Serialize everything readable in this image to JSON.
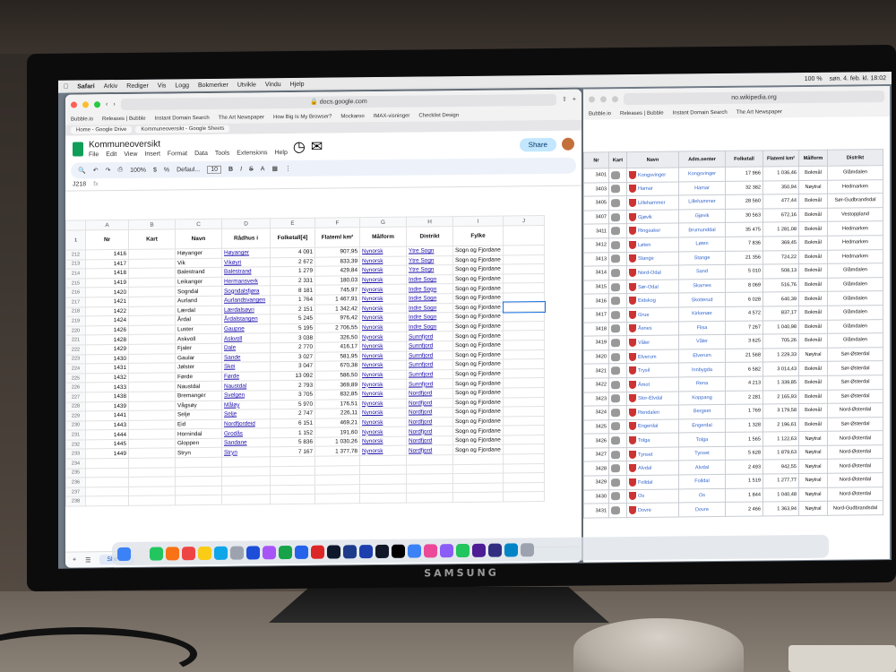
{
  "menubar": {
    "app": "Safari",
    "items": [
      "Arkiv",
      "Rediger",
      "Vis",
      "Logg",
      "Bokmerker",
      "Utvikle",
      "Vindu",
      "Hjelp"
    ],
    "clock": "søn. 4. feb. kl. 18:02",
    "battery": "100 %"
  },
  "left": {
    "url": "docs.google.com",
    "bookmarks": [
      "Bubble.io",
      "Releases | Bubble",
      "Instant Domain Search",
      "The Art Newspaper",
      "How Big Is My Browser?",
      "Mockaroo",
      "IMAX-visninger",
      "Checklist Design"
    ],
    "tabs": [
      "Home - Google Drive",
      "Kommuneoversikt - Google Sheets"
    ],
    "doc_title": "Kommuneoversikt",
    "menu": [
      "File",
      "Edit",
      "View",
      "Insert",
      "Format",
      "Data",
      "Tools",
      "Extensions",
      "Help"
    ],
    "share_label": "Share",
    "zoom": "100%",
    "font": "Defaul...",
    "font_size": "10",
    "cell_ref": "J218",
    "fx": "fx",
    "sheet_tab": "Sheet1",
    "col_letters": [
      "A",
      "B",
      "C",
      "D",
      "E",
      "F",
      "G",
      "H",
      "I",
      "J"
    ],
    "headers": [
      "Nr",
      "Kart",
      "Navn",
      "Rådhus i",
      "Folketall[4]",
      "Flateml km²",
      "Målform",
      "Distrikt",
      "Fylke",
      ""
    ],
    "rows": [
      {
        "rn": "212",
        "nr": "1416",
        "navn": "Høyanger",
        "rad": "Høyanger",
        "folk": "4 091",
        "flat": "907,95",
        "mal": "Nynorsk",
        "dist": "Ytre Sogn",
        "fyl": "Sogn og Fjordane"
      },
      {
        "rn": "213",
        "nr": "1417",
        "navn": "Vik",
        "rad": "Vikøyri",
        "folk": "2 672",
        "flat": "833,39",
        "mal": "Nynorsk",
        "dist": "Ytre Sogn",
        "fyl": "Sogn og Fjordane"
      },
      {
        "rn": "214",
        "nr": "1418",
        "navn": "Balestrand",
        "rad": "Balestrand",
        "folk": "1 279",
        "flat": "429,84",
        "mal": "Nynorsk",
        "dist": "Ytre Sogn",
        "fyl": "Sogn og Fjordane"
      },
      {
        "rn": "215",
        "nr": "1419",
        "navn": "Leikanger",
        "rad": "Hermansverk",
        "folk": "2 331",
        "flat": "180,03",
        "mal": "Nynorsk",
        "dist": "Indre Sogn",
        "fyl": "Sogn og Fjordane"
      },
      {
        "rn": "216",
        "nr": "1420",
        "navn": "Sogndal",
        "rad": "Sogndalsfjøra",
        "folk": "8 181",
        "flat": "745,97",
        "mal": "Nynorsk",
        "dist": "Indre Sogn",
        "fyl": "Sogn og Fjordane"
      },
      {
        "rn": "217",
        "nr": "1421",
        "navn": "Aurland",
        "rad": "Aurlandsvangen",
        "folk": "1 764",
        "flat": "1 467,91",
        "mal": "Nynorsk",
        "dist": "Indre Sogn",
        "fyl": "Sogn og Fjordane"
      },
      {
        "rn": "218",
        "nr": "1422",
        "navn": "Lærdal",
        "rad": "Lærdalsøyri",
        "folk": "2 151",
        "flat": "1 342,42",
        "mal": "Nynorsk",
        "dist": "Indre Sogn",
        "fyl": "Sogn og Fjordane"
      },
      {
        "rn": "219",
        "nr": "1424",
        "navn": "Årdal",
        "rad": "Årdalstangen",
        "folk": "5 245",
        "flat": "976,42",
        "mal": "Nynorsk",
        "dist": "Indre Sogn",
        "fyl": "Sogn og Fjordane"
      },
      {
        "rn": "220",
        "nr": "1426",
        "navn": "Luster",
        "rad": "Gaupne",
        "folk": "5 195",
        "flat": "2 706,55",
        "mal": "Nynorsk",
        "dist": "Indre Sogn",
        "fyl": "Sogn og Fjordane"
      },
      {
        "rn": "221",
        "nr": "1428",
        "navn": "Askvoll",
        "rad": "Askvoll",
        "folk": "3 038",
        "flat": "326,50",
        "mal": "Nynorsk",
        "dist": "Sunnfjord",
        "fyl": "Sogn og Fjordane"
      },
      {
        "rn": "222",
        "nr": "1429",
        "navn": "Fjaler",
        "rad": "Dale",
        "folk": "2 770",
        "flat": "416,17",
        "mal": "Nynorsk",
        "dist": "Sunnfjord",
        "fyl": "Sogn og Fjordane"
      },
      {
        "rn": "223",
        "nr": "1430",
        "navn": "Gaular",
        "rad": "Sande",
        "folk": "3 027",
        "flat": "581,95",
        "mal": "Nynorsk",
        "dist": "Sunnfjord",
        "fyl": "Sogn og Fjordane"
      },
      {
        "rn": "224",
        "nr": "1431",
        "navn": "Jølster",
        "rad": "Skei",
        "folk": "3 047",
        "flat": "670,38",
        "mal": "Nynorsk",
        "dist": "Sunnfjord",
        "fyl": "Sogn og Fjordane"
      },
      {
        "rn": "225",
        "nr": "1432",
        "navn": "Førde",
        "rad": "Førde",
        "folk": "13 092",
        "flat": "586,50",
        "mal": "Nynorsk",
        "dist": "Sunnfjord",
        "fyl": "Sogn og Fjordane"
      },
      {
        "rn": "226",
        "nr": "1433",
        "navn": "Naustdal",
        "rad": "Naustdal",
        "folk": "2 793",
        "flat": "369,89",
        "mal": "Nynorsk",
        "dist": "Sunnfjord",
        "fyl": "Sogn og Fjordane"
      },
      {
        "rn": "227",
        "nr": "1438",
        "navn": "Bremanger",
        "rad": "Svelgen",
        "folk": "3 705",
        "flat": "832,85",
        "mal": "Nynorsk",
        "dist": "Nordfjord",
        "fyl": "Sogn og Fjordane"
      },
      {
        "rn": "228",
        "nr": "1439",
        "navn": "Vågsøy",
        "rad": "Måløy",
        "folk": "5 970",
        "flat": "176,51",
        "mal": "Nynorsk",
        "dist": "Nordfjord",
        "fyl": "Sogn og Fjordane"
      },
      {
        "rn": "229",
        "nr": "1441",
        "navn": "Selje",
        "rad": "Selje",
        "folk": "2 747",
        "flat": "226,11",
        "mal": "Nynorsk",
        "dist": "Nordfjord",
        "fyl": "Sogn og Fjordane"
      },
      {
        "rn": "230",
        "nr": "1443",
        "navn": "Eid",
        "rad": "Nordfjordeid",
        "folk": "6 151",
        "flat": "469,21",
        "mal": "Nynorsk",
        "dist": "Nordfjord",
        "fyl": "Sogn og Fjordane"
      },
      {
        "rn": "231",
        "nr": "1444",
        "navn": "Hornindal",
        "rad": "Grodås",
        "folk": "1 152",
        "flat": "191,60",
        "mal": "Nynorsk",
        "dist": "Nordfjord",
        "fyl": "Sogn og Fjordane"
      },
      {
        "rn": "232",
        "nr": "1445",
        "navn": "Gloppen",
        "rad": "Sandane",
        "folk": "5 836",
        "flat": "1 030,26",
        "mal": "Nynorsk",
        "dist": "Nordfjord",
        "fyl": "Sogn og Fjordane"
      },
      {
        "rn": "233",
        "nr": "1449",
        "navn": "Stryn",
        "rad": "Stryn",
        "folk": "7 167",
        "flat": "1 377,78",
        "mal": "Nynorsk",
        "dist": "Nordfjord",
        "fyl": "Sogn og Fjordane"
      }
    ],
    "empty_rows": [
      "234",
      "235",
      "236",
      "237",
      "238"
    ]
  },
  "right": {
    "url": "no.wikipedia.org",
    "bookmarks": [
      "Bubble.io",
      "Releases | Bubble",
      "Instant Domain Search",
      "The Art Newspaper"
    ],
    "headers": [
      "Nr",
      "Kart",
      "Navn",
      "Adm.senter",
      "Folketall",
      "Flateml km²",
      "Målform",
      "Distrikt"
    ],
    "rows": [
      {
        "nr": "3401",
        "navn": "Kongsvinger",
        "adm": "Kongsvinger",
        "folk": "17 966",
        "flat": "1 036,46",
        "mal": "Bokmål",
        "dist": "Glåmdalen"
      },
      {
        "nr": "3403",
        "navn": "Hamar",
        "adm": "Hamar",
        "folk": "32 382",
        "flat": "350,94",
        "mal": "Nøytral",
        "dist": "Hedmarken"
      },
      {
        "nr": "3405",
        "navn": "Lillehammer",
        "adm": "Lillehammer",
        "folk": "28 560",
        "flat": "477,44",
        "mal": "Bokmål",
        "dist": "Sør-Gudbrandsdal"
      },
      {
        "nr": "3407",
        "navn": "Gjøvik",
        "adm": "Gjøvik",
        "folk": "30 563",
        "flat": "672,16",
        "mal": "Bokmål",
        "dist": "Vestoppland"
      },
      {
        "nr": "3411",
        "navn": "Ringsaker",
        "adm": "Brumunddal",
        "folk": "35 475",
        "flat": "1 281,08",
        "mal": "Bokmål",
        "dist": "Hedmarken"
      },
      {
        "nr": "3412",
        "navn": "Løten",
        "adm": "Løten",
        "folk": "7 836",
        "flat": "369,45",
        "mal": "Bokmål",
        "dist": "Hedmarken"
      },
      {
        "nr": "3413",
        "navn": "Stange",
        "adm": "Stange",
        "folk": "21 356",
        "flat": "724,22",
        "mal": "Bokmål",
        "dist": "Hedmarken"
      },
      {
        "nr": "3414",
        "navn": "Nord-Odal",
        "adm": "Sand",
        "folk": "5 010",
        "flat": "508,13",
        "mal": "Bokmål",
        "dist": "Glåmdalen"
      },
      {
        "nr": "3415",
        "navn": "Sør-Odal",
        "adm": "Skarnes",
        "folk": "8 069",
        "flat": "516,76",
        "mal": "Bokmål",
        "dist": "Glåmdalen"
      },
      {
        "nr": "3416",
        "navn": "Eidskog",
        "adm": "Skotterud",
        "folk": "6 028",
        "flat": "640,39",
        "mal": "Bokmål",
        "dist": "Glåmdalen"
      },
      {
        "nr": "3417",
        "navn": "Grue",
        "adm": "Kirkenær",
        "folk": "4 572",
        "flat": "837,17",
        "mal": "Bokmål",
        "dist": "Glåmdalen"
      },
      {
        "nr": "3418",
        "navn": "Åsnes",
        "adm": "Flisa",
        "folk": "7 267",
        "flat": "1 040,98",
        "mal": "Bokmål",
        "dist": "Glåmdalen"
      },
      {
        "nr": "3419",
        "navn": "Våler",
        "adm": "Våler",
        "folk": "3 625",
        "flat": "705,26",
        "mal": "Bokmål",
        "dist": "Glåmdalen"
      },
      {
        "nr": "3420",
        "navn": "Elverum",
        "adm": "Elverum",
        "folk": "21 568",
        "flat": "1 229,33",
        "mal": "Nøytral",
        "dist": "Sør-Østerdal"
      },
      {
        "nr": "3421",
        "navn": "Trysil",
        "adm": "Innbygda",
        "folk": "6 582",
        "flat": "3 014,43",
        "mal": "Bokmål",
        "dist": "Sør-Østerdal"
      },
      {
        "nr": "3422",
        "navn": "Åmot",
        "adm": "Rena",
        "folk": "4 213",
        "flat": "1 339,85",
        "mal": "Bokmål",
        "dist": "Sør-Østerdal"
      },
      {
        "nr": "3423",
        "navn": "Stor-Elvdal",
        "adm": "Koppang",
        "folk": "2 281",
        "flat": "2 165,93",
        "mal": "Bokmål",
        "dist": "Sør-Østerdal"
      },
      {
        "nr": "3424",
        "navn": "Rendalen",
        "adm": "Bergset",
        "folk": "1 769",
        "flat": "3 179,58",
        "mal": "Bokmål",
        "dist": "Nord-Østerdal"
      },
      {
        "nr": "3425",
        "navn": "Engerdal",
        "adm": "Engerdal",
        "folk": "1 328",
        "flat": "2 196,61",
        "mal": "Bokmål",
        "dist": "Sør-Østerdal"
      },
      {
        "nr": "3426",
        "navn": "Tolga",
        "adm": "Tolga",
        "folk": "1 565",
        "flat": "1 122,63",
        "mal": "Nøytral",
        "dist": "Nord-Østerdal"
      },
      {
        "nr": "3427",
        "navn": "Tynset",
        "adm": "Tynset",
        "folk": "5 628",
        "flat": "1 879,63",
        "mal": "Nøytral",
        "dist": "Nord-Østerdal"
      },
      {
        "nr": "3428",
        "navn": "Alvdal",
        "adm": "Alvdal",
        "folk": "2 493",
        "flat": "942,55",
        "mal": "Nøytral",
        "dist": "Nord-Østerdal"
      },
      {
        "nr": "3429",
        "navn": "Folldal",
        "adm": "Folldal",
        "folk": "1 519",
        "flat": "1 277,77",
        "mal": "Nøytral",
        "dist": "Nord-Østerdal"
      },
      {
        "nr": "3430",
        "navn": "Os",
        "adm": "Os",
        "folk": "1 844",
        "flat": "1 040,48",
        "mal": "Nøytral",
        "dist": "Nord-Østerdal"
      },
      {
        "nr": "3431",
        "navn": "Dovre",
        "adm": "Dovre",
        "folk": "2 466",
        "flat": "1 363,94",
        "mal": "Nøytral",
        "dist": "Nord-Gudbrandsdal"
      }
    ]
  },
  "brand": "SAMSUNG"
}
